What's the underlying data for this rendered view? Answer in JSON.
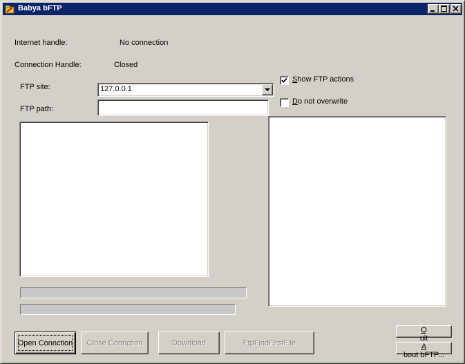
{
  "window": {
    "title": "Babya bFTP",
    "app_icon": "bftp-app-icon",
    "controls": [
      "minimize-icon",
      "maximize-icon",
      "close-icon"
    ]
  },
  "status": {
    "internet_handle_label": "Internet handle:",
    "internet_handle_value": "No connection",
    "connection_handle_label": "Connection Handle:",
    "connection_handle_value": "Closed"
  },
  "form": {
    "ftp_site_label": "FTP site:",
    "ftp_site_value": "127.0.0.1",
    "ftp_path_label": "FTP path:",
    "ftp_path_value": ""
  },
  "options": {
    "show_ftp_actions": {
      "label_first": "S",
      "label_rest": "how FTP actions",
      "checked": true
    },
    "do_not_overwrite": {
      "label_first": "D",
      "label_rest": "o not overwrite",
      "checked": false
    }
  },
  "buttons": {
    "open": "Open Connction",
    "close": "Close Connction",
    "download": "Download",
    "find_first": "FtpFindFirstFile",
    "quit_first": "Q",
    "quit_rest": "uit",
    "about_first": "A",
    "about_rest": "bout bFTP..."
  }
}
